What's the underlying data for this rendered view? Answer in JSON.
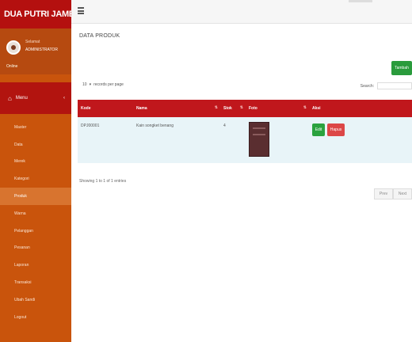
{
  "app": {
    "brand": "DUA PUTRI JAMBI"
  },
  "user": {
    "role": "Selamat",
    "name": "ADMINISTRATOR",
    "status": "Online"
  },
  "sidebar": {
    "header": {
      "label": "Menu"
    },
    "items": [
      {
        "label": "Master"
      },
      {
        "label": "Data"
      },
      {
        "label": "Merek"
      },
      {
        "label": "Kategori"
      },
      {
        "label": "Produk"
      },
      {
        "label": "Warna"
      },
      {
        "label": "Pelanggan"
      },
      {
        "label": "Pesanan"
      },
      {
        "label": "Laporan"
      },
      {
        "label": "Transaksi"
      },
      {
        "label": "Ubah Sandi"
      },
      {
        "label": "Logout"
      }
    ]
  },
  "page": {
    "title": "DATA PRODUK"
  },
  "toolbar": {
    "add_label": "Tambah"
  },
  "table_controls": {
    "length_value": "10",
    "length_suffix": "records per page",
    "search_label": "Search:"
  },
  "table": {
    "headers": [
      "Kode",
      "Nama",
      "Stok",
      "Foto",
      "Aksi"
    ],
    "rows": [
      {
        "code": "DPJ00001",
        "name": "Kain songket benang",
        "stock": "4",
        "edit": "Edit",
        "delete": "Hapus"
      }
    ]
  },
  "footer": {
    "info": "Showing 1 to 1 of 1 entries",
    "prev": "Prev",
    "next": "Next"
  },
  "colors": {
    "sidebar": "#c9540c",
    "header": "#c0171c",
    "brand": "#b4100f",
    "accent_green": "#2a9b3c",
    "accent_red": "#dc4747"
  }
}
